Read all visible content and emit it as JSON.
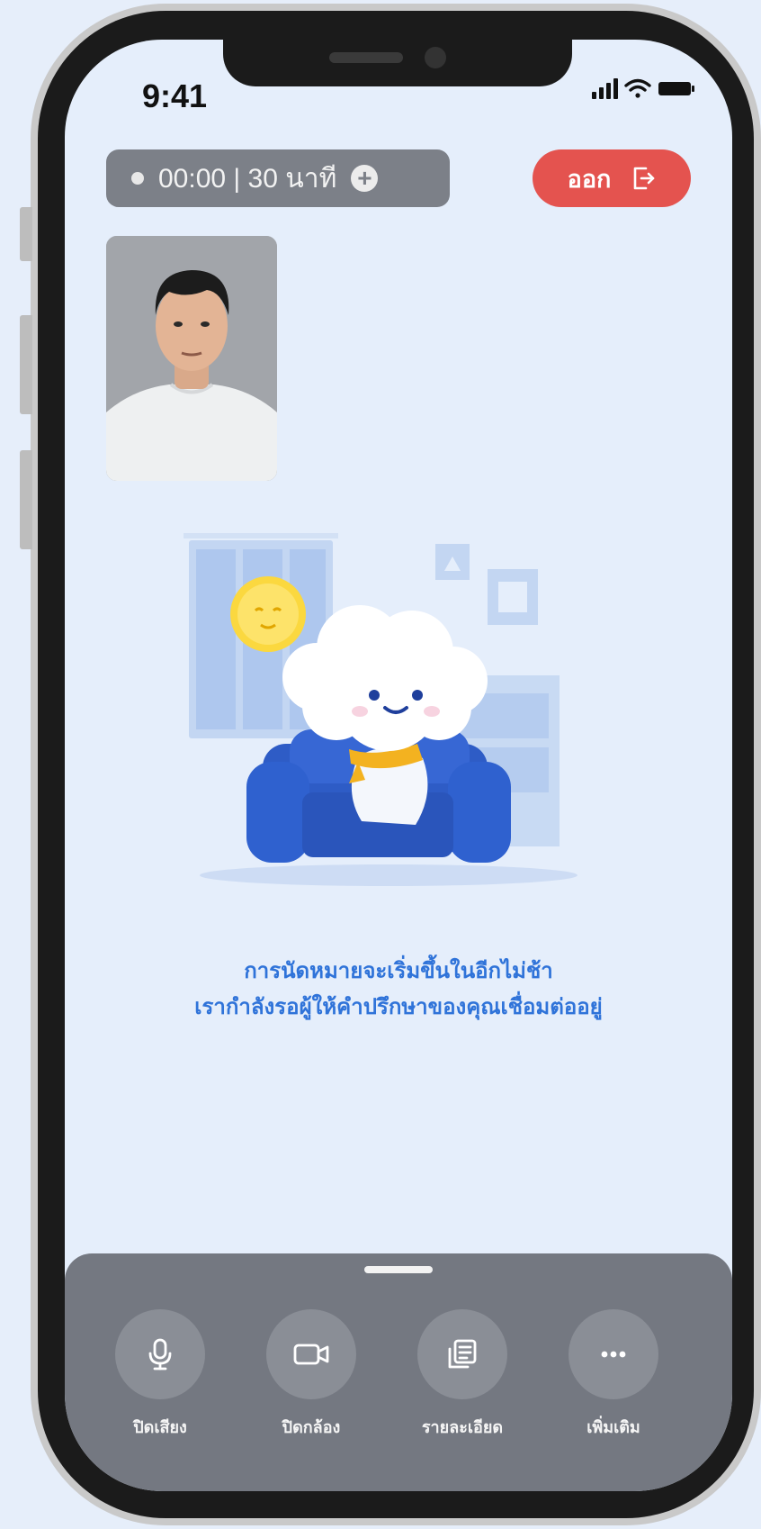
{
  "status_bar": {
    "time": "9:41"
  },
  "call": {
    "timer": "00:00 | 30 นาที",
    "leave_label": "ออก"
  },
  "waiting": {
    "line1": "การนัดหมายจะเริ่มขึ้นในอีกไม่ช้า",
    "line2": "เรากำลังรอผู้ให้คำปรึกษาของคุณเชื่อมต่ออยู่"
  },
  "controls": [
    {
      "label": "ปิดเสียง",
      "icon": "microphone-icon"
    },
    {
      "label": "ปิดกล้อง",
      "icon": "video-camera-icon"
    },
    {
      "label": "รายละเอียด",
      "icon": "document-icon"
    },
    {
      "label": "เพิ่มเติม",
      "icon": "more-icon"
    }
  ],
  "colors": {
    "accent_blue": "#2f73d9",
    "leave_red": "#e4534f",
    "panel_gray": "#747881",
    "screen_bg": "#e5eefb"
  }
}
